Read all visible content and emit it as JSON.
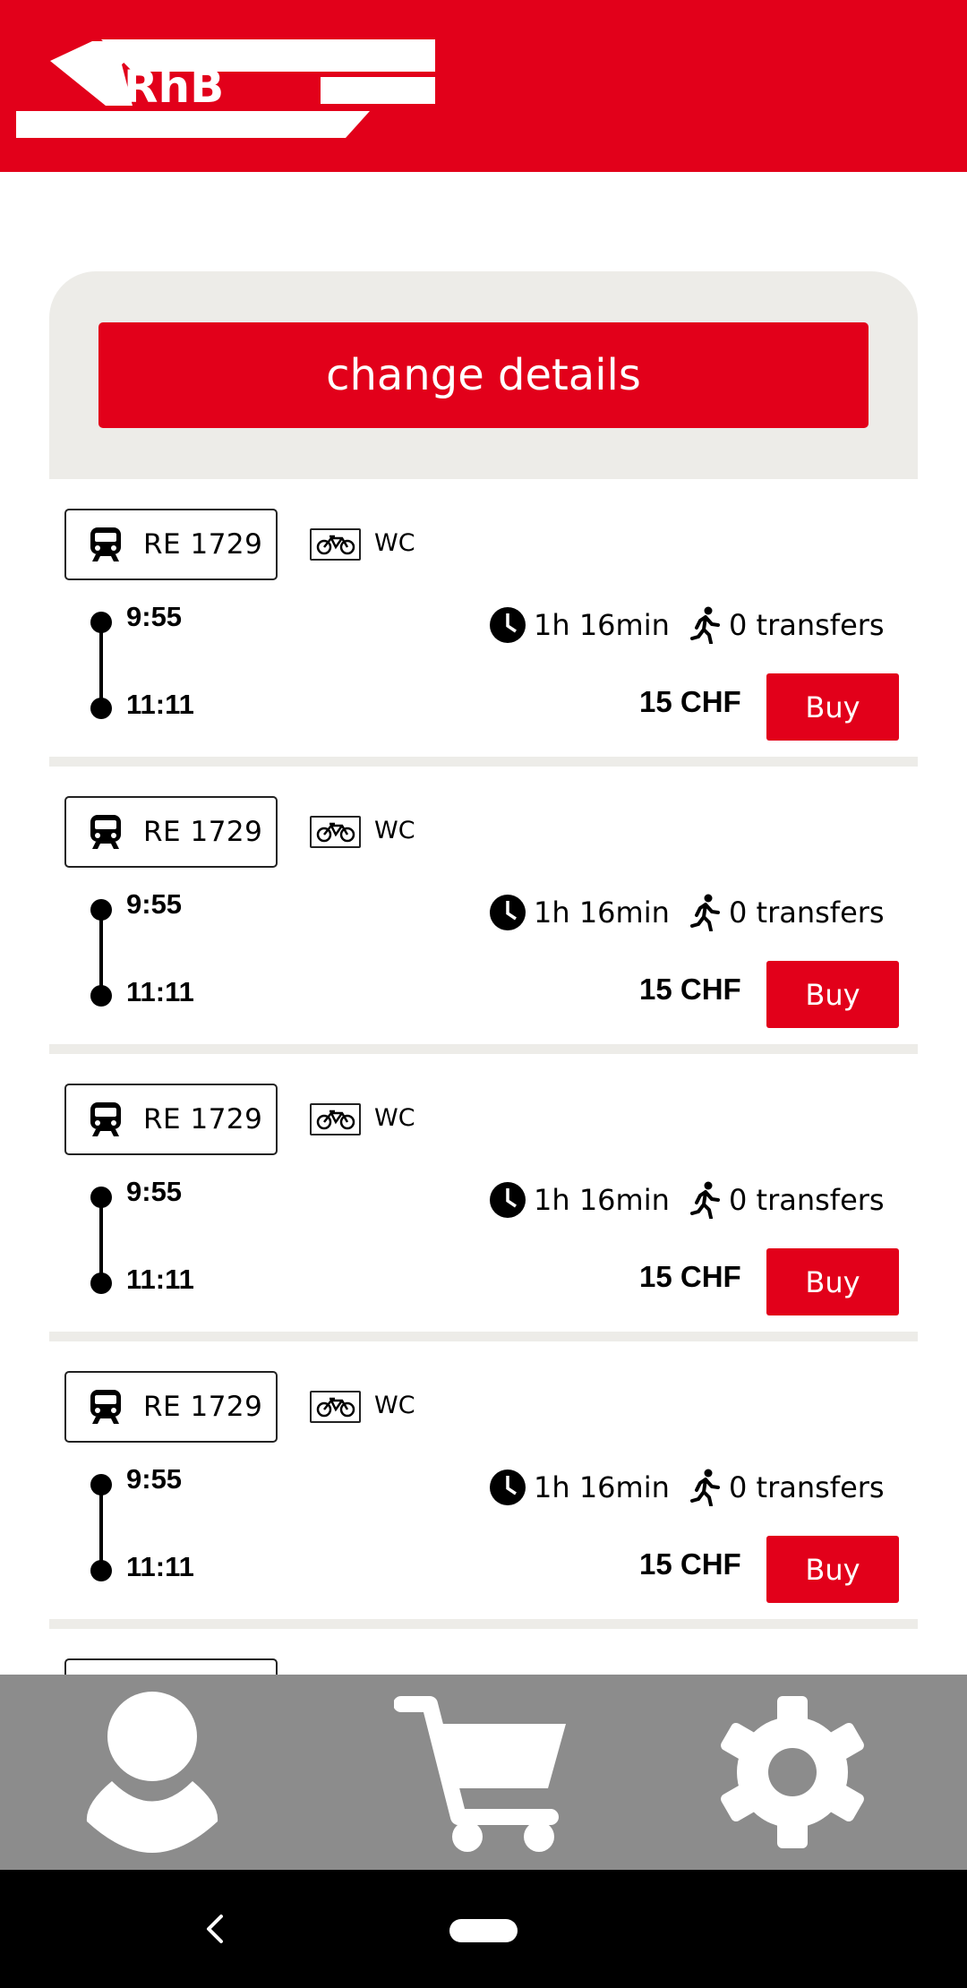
{
  "app": {
    "logo_text": "RhB",
    "brand_color": "#e2001a",
    "panel_color": "#edece8",
    "nav_color": "#8c8c8c"
  },
  "details": {
    "change_label": "change details"
  },
  "connections": [
    {
      "train": "RE 1729",
      "amenity": "WC",
      "departure": "9:55",
      "arrival": "11:11",
      "duration": "1h 16min",
      "transfers": "0 transfers",
      "price": "15 CHF",
      "buy_label": "Buy"
    },
    {
      "train": "RE 1729",
      "amenity": "WC",
      "departure": "9:55",
      "arrival": "11:11",
      "duration": "1h 16min",
      "transfers": "0 transfers",
      "price": "15 CHF",
      "buy_label": "Buy"
    },
    {
      "train": "RE 1729",
      "amenity": "WC",
      "departure": "9:55",
      "arrival": "11:11",
      "duration": "1h 16min",
      "transfers": "0 transfers",
      "price": "15 CHF",
      "buy_label": "Buy"
    },
    {
      "train": "RE 1729",
      "amenity": "WC",
      "departure": "9:55",
      "arrival": "11:11",
      "duration": "1h 16min",
      "transfers": "0 transfers",
      "price": "15 CHF",
      "buy_label": "Buy"
    }
  ],
  "icons": {
    "train": "train-icon",
    "bike": "bicycle-icon",
    "clock": "clock-icon",
    "walk": "walking-icon",
    "profile": "user-icon",
    "cart": "shopping-cart-icon",
    "settings": "gear-icon",
    "back": "back-chevron-icon",
    "home": "home-pill-icon"
  }
}
